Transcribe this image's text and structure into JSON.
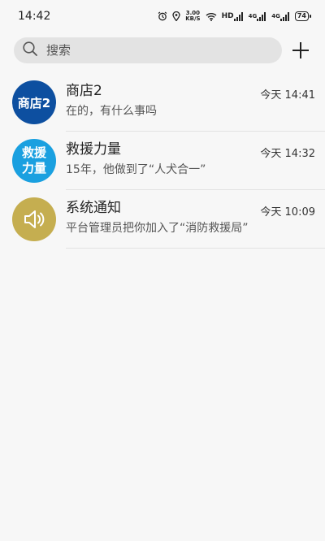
{
  "status_bar": {
    "time": "14:42",
    "net_speed_value": "3.00",
    "net_speed_unit": "KB/S",
    "network_1": "HD",
    "network_2": "4G",
    "network_3": "4G",
    "battery": "74"
  },
  "search": {
    "placeholder": "搜索"
  },
  "conversations": [
    {
      "name": "商店2",
      "preview": "在的，有什么事吗",
      "time": "今天 14:41",
      "avatar_text": "商店2",
      "avatar_color": "#0d4fa0"
    },
    {
      "name": "救援力量",
      "preview": "15年，他做到了“人犬合一”",
      "time": "今天 14:32",
      "avatar_line1": "救援",
      "avatar_line2": "力量",
      "avatar_color": "#1aa0e0"
    },
    {
      "name": "系统通知",
      "preview": "平台管理员把你加入了“消防救援局”",
      "time": "今天 10:09",
      "avatar_icon": "speaker-icon",
      "avatar_color": "#c5ae50"
    }
  ]
}
